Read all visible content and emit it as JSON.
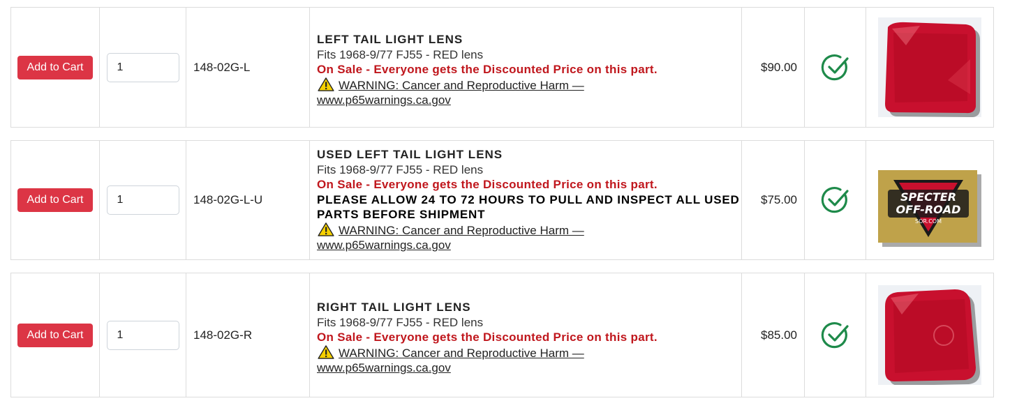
{
  "items": [
    {
      "add_label": "Add to Cart",
      "qty": "1",
      "sku": "148-02G-L",
      "title": "LEFT TAIL LIGHT LENS",
      "fits": "Fits 1968-9/77 FJ55 - RED lens",
      "sale": "On Sale - Everyone gets the Discounted Price on this part.",
      "warning_text": "WARNING: Cancer and Reproductive Harm —",
      "warning_link": "www.p65warnings.ca.gov",
      "price": "$90.00",
      "stock_icon": "check-circle-icon"
    },
    {
      "add_label": "Add to Cart",
      "qty": "1",
      "sku": "148-02G-L-U",
      "title": "USED LEFT TAIL LIGHT LENS",
      "fits": "Fits 1968-9/77 FJ55 - RED lens",
      "sale": "On Sale - Everyone gets the Discounted Price on this part.",
      "notice": "PLEASE ALLOW 24 TO 72 HOURS TO PULL AND INSPECT ALL USED PARTS BEFORE SHIPMENT",
      "warning_text": "WARNING: Cancer and Reproductive Harm —",
      "warning_link": "www.p65warnings.ca.gov",
      "price": "$75.00",
      "stock_icon": "check-circle-icon",
      "logo_text": [
        "SPECTER",
        "OFF-ROAD",
        "SOR.COM"
      ]
    },
    {
      "add_label": "Add to Cart",
      "qty": "1",
      "sku": "148-02G-R",
      "title": "RIGHT TAIL LIGHT LENS",
      "fits": "Fits 1968-9/77 FJ55 - RED lens",
      "sale": "On Sale - Everyone gets the Discounted Price on this part.",
      "warning_text": "WARNING: Cancer and Reproductive Harm —",
      "warning_link": "www.p65warnings.ca.gov",
      "price": "$85.00",
      "stock_icon": "check-circle-icon"
    }
  ],
  "colors": {
    "button": "#dc3545",
    "sale": "#c0171d",
    "check": "#1e8a4a",
    "lens": "#c8102e"
  }
}
